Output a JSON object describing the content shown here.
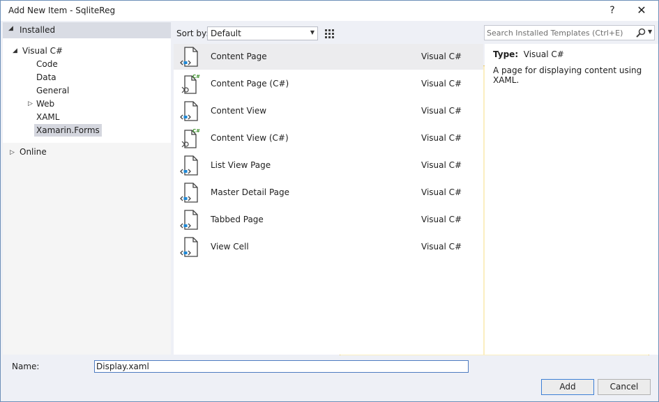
{
  "window": {
    "title": "Add New Item - SqliteReg",
    "help_label": "?",
    "close_label": "✕"
  },
  "tree": {
    "installed_label": "Installed",
    "visual_csharp_label": "Visual C#",
    "children": [
      "Code",
      "Data",
      "General",
      "Web",
      "XAML",
      "Xamarin.Forms"
    ],
    "selected": "Xamarin.Forms",
    "online_label": "Online"
  },
  "sort": {
    "label": "Sort by:",
    "value": "Default"
  },
  "templates": [
    {
      "name": "Content Page",
      "lang": "Visual C#",
      "icon": "xaml-page-icon"
    },
    {
      "name": "Content Page (C#)",
      "lang": "Visual C#",
      "icon": "csharp-page-icon"
    },
    {
      "name": "Content View",
      "lang": "Visual C#",
      "icon": "xaml-page-icon"
    },
    {
      "name": "Content View (C#)",
      "lang": "Visual C#",
      "icon": "csharp-page-icon"
    },
    {
      "name": "List View Page",
      "lang": "Visual C#",
      "icon": "xaml-page-icon"
    },
    {
      "name": "Master Detail Page",
      "lang": "Visual C#",
      "icon": "xaml-page-icon"
    },
    {
      "name": "Tabbed Page",
      "lang": "Visual C#",
      "icon": "xaml-page-icon"
    },
    {
      "name": "View Cell",
      "lang": "Visual C#",
      "icon": "xaml-page-icon"
    }
  ],
  "search": {
    "placeholder": "Search Installed Templates (Ctrl+E)"
  },
  "details": {
    "type_label": "Type:",
    "type_value": "Visual C#",
    "description": "A page for displaying content using XAML."
  },
  "footer": {
    "name_label": "Name:",
    "name_value": "Display.xaml",
    "add_label": "Add",
    "cancel_label": "Cancel"
  },
  "colors": {
    "accent": "#3c7fd6",
    "selection": "#d4d6de",
    "view_toggle_active": "#fbeec0",
    "icon_blue": "#1e88d6",
    "icon_green": "#3b8f2a"
  }
}
